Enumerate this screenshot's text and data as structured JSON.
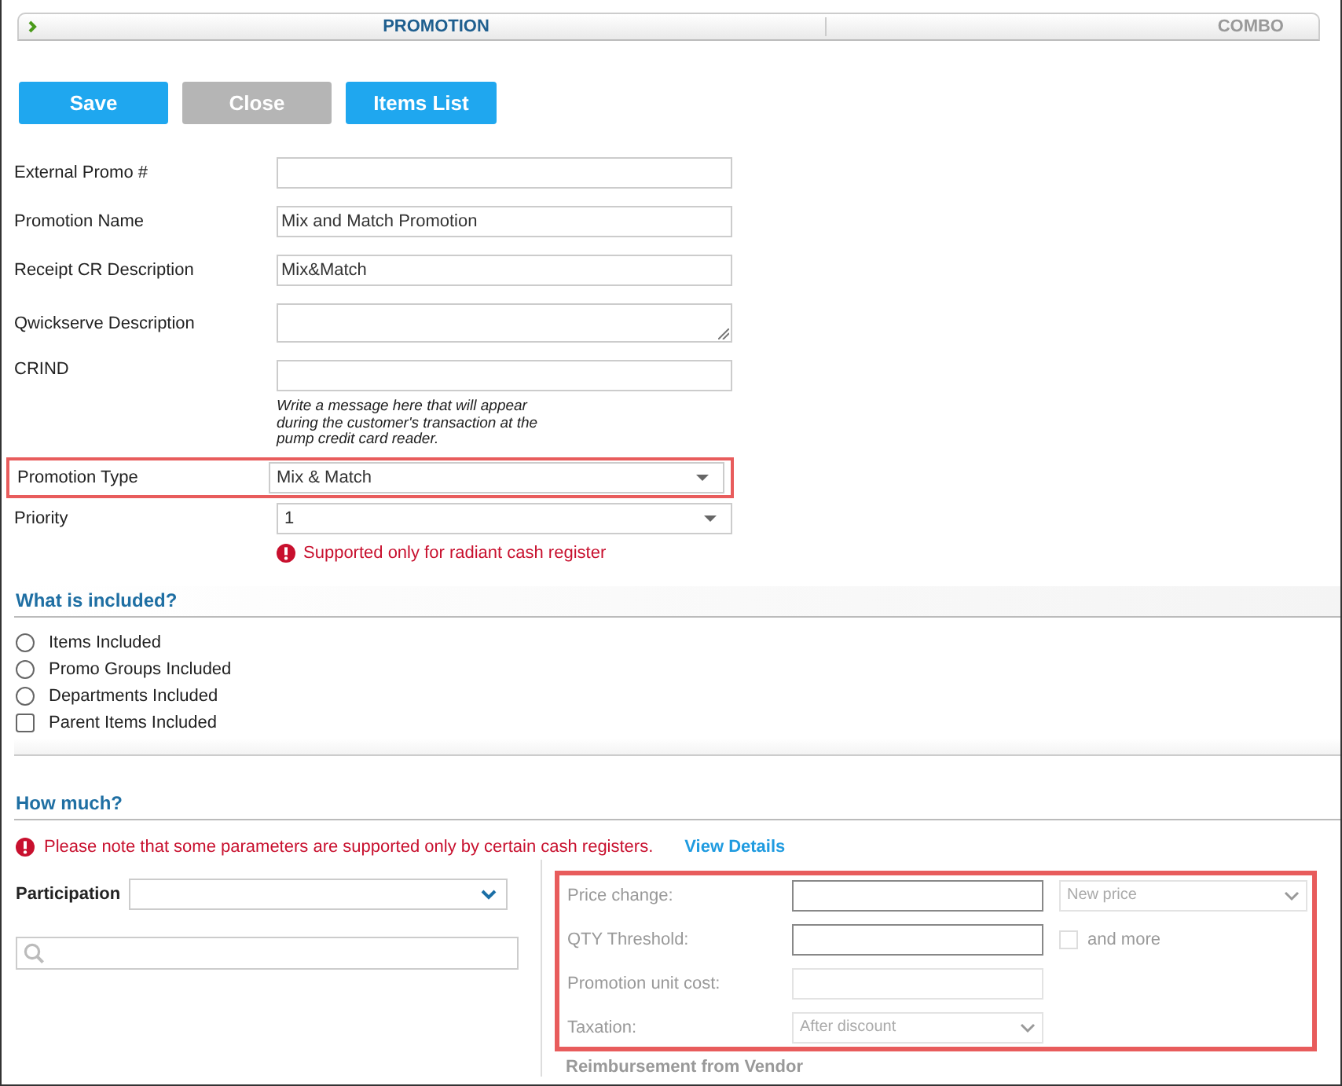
{
  "tabs": [
    {
      "label": "PROMOTION",
      "selected": true
    },
    {
      "label": "COMBO",
      "selected": false
    }
  ],
  "buttons": [
    {
      "label": "Save",
      "disabled": false
    },
    {
      "label": "Close",
      "disabled": true
    },
    {
      "label": "Items List",
      "disabled": false
    }
  ],
  "fields": [
    {
      "label": "External Promo #",
      "kind": "text"
    },
    {
      "label": "Promotion Name",
      "kind": "text",
      "value": "Mix and Match Promotion"
    },
    {
      "label": "Receipt CR Description",
      "kind": "text",
      "value": "Mix&Match"
    },
    {
      "label": "Qwickserve Description",
      "kind": "textarea"
    },
    {
      "label": "CRIND",
      "kind": "text",
      "hint": "Write a message here that will appear during the customer's transaction at the pump credit card reader."
    },
    {
      "label": "Promotion Type",
      "kind": "select",
      "value": "Mix & Match",
      "highlighted": true
    },
    {
      "label": "Priority",
      "kind": "select",
      "value": "1",
      "note": "Supported only for radiant cash register"
    }
  ],
  "included": {
    "title": "What is included?",
    "options": [
      {
        "label": "Items Included",
        "kind": "radio",
        "checked": false
      },
      {
        "label": "Promo Groups Included",
        "kind": "radio",
        "checked": false
      },
      {
        "label": "Departments Included",
        "kind": "radio",
        "checked": false
      },
      {
        "label": "Parent Items Included",
        "kind": "checkbox",
        "checked": false
      }
    ]
  },
  "how_much": {
    "title": "How much?",
    "note": "Please note that some parameters are supported only by certain cash registers.",
    "link": "View Details",
    "participation": {
      "label": "Participation"
    },
    "highlighted": true,
    "parameters": [
      {
        "label": "Price change:",
        "kind": "input",
        "select": "New price"
      },
      {
        "label": "QTY Threshold:",
        "kind": "input",
        "checkbox": {
          "label": "and more",
          "checked": false
        }
      },
      {
        "label": "Promotion unit cost:",
        "kind": "disabled-input"
      },
      {
        "label": "Taxation:",
        "kind": "select",
        "value": "After discount"
      }
    ],
    "next_section": "Reimbursement from Vendor"
  }
}
